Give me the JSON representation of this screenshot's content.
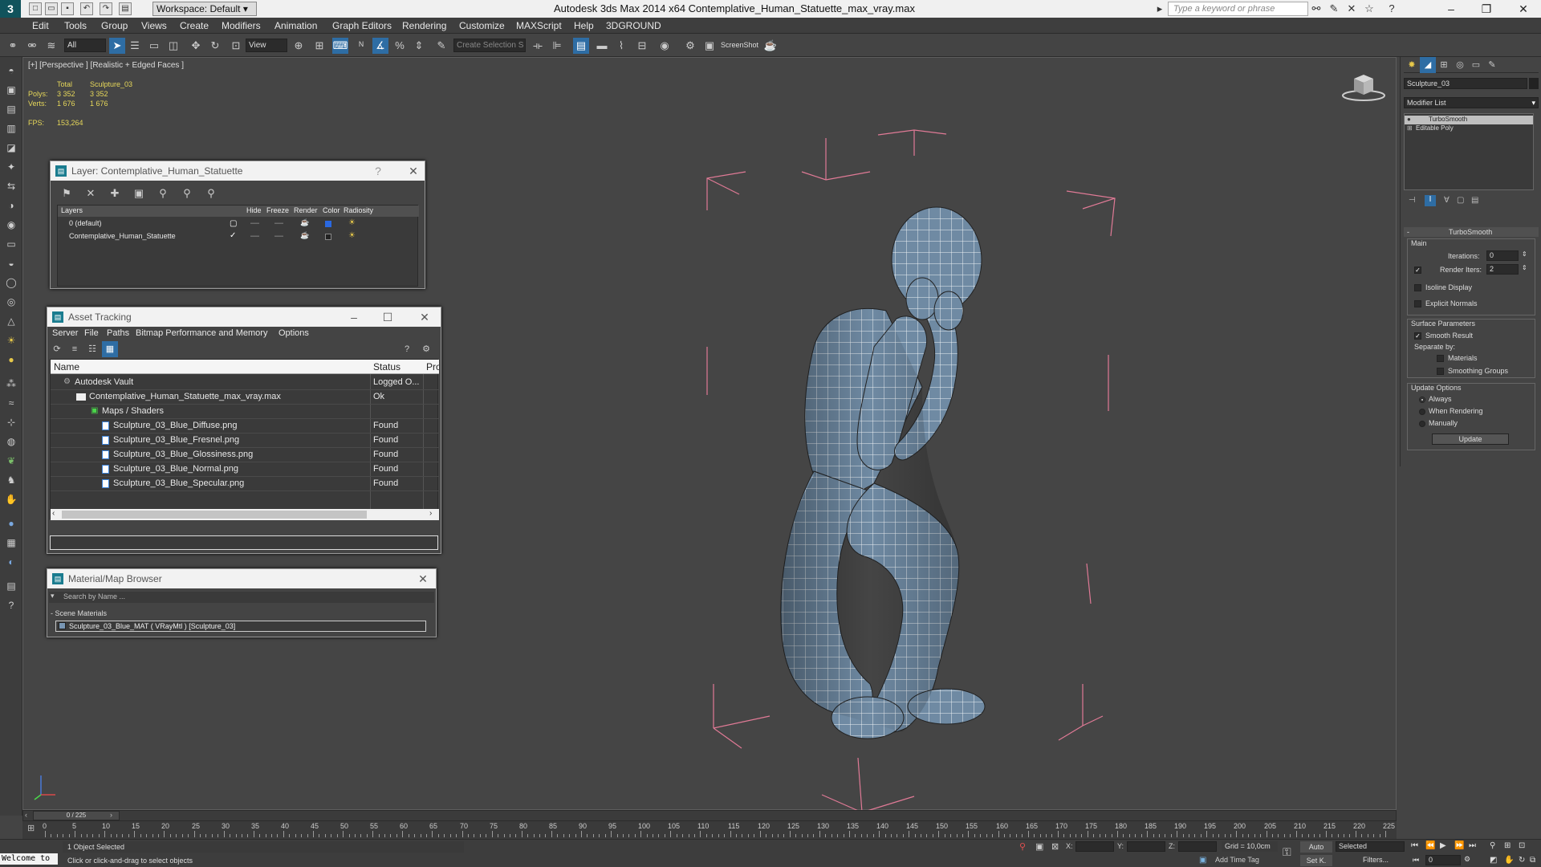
{
  "titlebar": {
    "workspace": "Workspace: Default",
    "app_title": "Autodesk 3ds Max  2014 x64     Contemplative_Human_Statuette_max_vray.max",
    "search_placeholder": "Type a keyword or phrase"
  },
  "menu": [
    "Edit",
    "Tools",
    "Group",
    "Views",
    "Create",
    "Modifiers",
    "Animation",
    "Graph Editors",
    "Rendering",
    "Customize",
    "MAXScript",
    "Help",
    "3DGROUND"
  ],
  "toolbar": {
    "filter": "All",
    "ref_coord": "View",
    "selection_set": "Create Selection S",
    "screenshot_label": "ScreenShot"
  },
  "viewport": {
    "label": "[+] [Perspective ] [Realistic + Edged Faces ]",
    "stats": {
      "col_total": "Total",
      "col_object": "Sculpture_03",
      "polys_label": "Polys:",
      "polys_total": "3 352",
      "polys_obj": "3 352",
      "verts_label": "Verts:",
      "verts_total": "1 676",
      "verts_obj": "1 676",
      "fps_label": "FPS:",
      "fps_value": "153,264"
    }
  },
  "layer_window": {
    "title": "Layer: Contemplative_Human_Statuette",
    "help": "?",
    "headers": [
      "Layers",
      "Hide",
      "Freeze",
      "Render",
      "Color",
      "Radiosity"
    ],
    "rows": [
      {
        "name": "0 (default)"
      },
      {
        "name": "Contemplative_Human_Statuette"
      }
    ]
  },
  "asset_window": {
    "title": "Asset Tracking",
    "menus": [
      "Server",
      "File",
      "Paths",
      "Bitmap Performance and Memory",
      "Options"
    ],
    "columns": [
      "Name",
      "Status",
      "Pro"
    ],
    "rows": [
      {
        "name": "Autodesk Vault",
        "status": "Logged O..."
      },
      {
        "name": "Contemplative_Human_Statuette_max_vray.max",
        "status": "Ok"
      },
      {
        "name": "Maps / Shaders",
        "status": ""
      },
      {
        "name": "Sculpture_03_Blue_Diffuse.png",
        "status": "Found"
      },
      {
        "name": "Sculpture_03_Blue_Fresnel.png",
        "status": "Found"
      },
      {
        "name": "Sculpture_03_Blue_Glossiness.png",
        "status": "Found"
      },
      {
        "name": "Sculpture_03_Blue_Normal.png",
        "status": "Found"
      },
      {
        "name": "Sculpture_03_Blue_Specular.png",
        "status": "Found"
      }
    ]
  },
  "material_window": {
    "title": "Material/Map Browser",
    "search_placeholder": "Search by Name ...",
    "group": "- Scene Materials",
    "item": "Sculpture_03_Blue_MAT ( VRayMtl ) [Sculpture_03]"
  },
  "command_panel": {
    "object_name": "Sculpture_03",
    "modifier_list": "Modifier List",
    "stack": [
      "TurboSmooth",
      "Editable Poly"
    ],
    "rollout_title": "TurboSmooth",
    "main_group": "Main",
    "iterations_label": "Iterations:",
    "iterations_value": "0",
    "render_iters_label": "Render Iters:",
    "render_iters_value": "2",
    "isoline": "Isoline Display",
    "explicit_normals": "Explicit Normals",
    "surface_group": "Surface Parameters",
    "smooth_result": "Smooth Result",
    "separate_by": "Separate by:",
    "materials": "Materials",
    "smoothing_groups": "Smoothing Groups",
    "update_group": "Update Options",
    "always": "Always",
    "when_rendering": "When Rendering",
    "manually": "Manually",
    "update_button": "Update"
  },
  "timeline": {
    "frame_label": "0 / 225",
    "ticks": [
      "0",
      "5",
      "10",
      "15",
      "20",
      "25",
      "30",
      "35",
      "40",
      "45",
      "50",
      "55",
      "60",
      "65",
      "70",
      "75",
      "80",
      "85",
      "90",
      "95",
      "100",
      "105",
      "110",
      "115",
      "120",
      "125",
      "130",
      "135",
      "140",
      "145",
      "150",
      "155",
      "160",
      "165",
      "170",
      "175",
      "180",
      "185",
      "190",
      "195",
      "200",
      "205",
      "210",
      "215",
      "220",
      "225"
    ]
  },
  "status": {
    "maxscript": "Welcome to",
    "selected": "1 Object Selected",
    "prompt": "Click or click-and-drag to select objects",
    "x_label": "X:",
    "y_label": "Y:",
    "z_label": "Z:",
    "grid": "Grid = 10,0cm",
    "add_time_tag": "Add Time Tag",
    "auto": "Auto",
    "selected_dd": "Selected",
    "setk": "Set K.",
    "filters": "Filters...",
    "frame": "0"
  }
}
